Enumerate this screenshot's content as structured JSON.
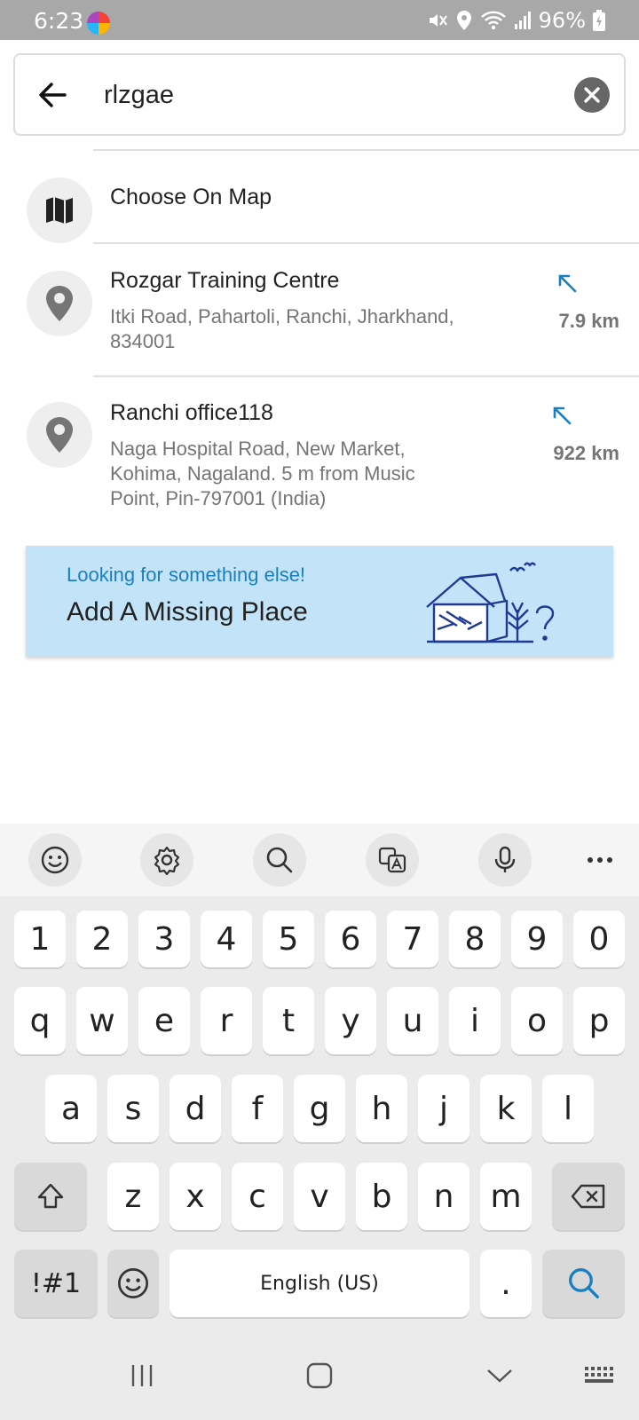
{
  "status_bar": {
    "time": "6:23",
    "battery": "96%"
  },
  "search": {
    "query": "rlzgae"
  },
  "results": [
    {
      "title": "Choose On Map"
    },
    {
      "title": "Rozgar Training Centre",
      "address_line1": "Itki Road, Pahartoli, Ranchi, Jharkhand,",
      "address_line2": "834001",
      "distance": "7.9 km"
    },
    {
      "title": "Ranchi office118",
      "address_line1": "Naga Hospital Road, New Market,",
      "address_line2": "Kohima, Nagaland. 5 m from Music",
      "address_line3": "Point, Pin-797001 (India)",
      "distance": "922 km"
    }
  ],
  "banner": {
    "subtitle": "Looking for something else!",
    "title": "Add A Missing Place"
  },
  "keyboard": {
    "numbers": [
      "1",
      "2",
      "3",
      "4",
      "5",
      "6",
      "7",
      "8",
      "9",
      "0"
    ],
    "row1": [
      "q",
      "w",
      "e",
      "r",
      "t",
      "y",
      "u",
      "i",
      "o",
      "p"
    ],
    "row2": [
      "a",
      "s",
      "d",
      "f",
      "g",
      "h",
      "j",
      "k",
      "l"
    ],
    "row3": [
      "z",
      "x",
      "c",
      "v",
      "b",
      "n",
      "m"
    ],
    "symbols_key": "!#1",
    "space_label": "English (US)",
    "period_key": "."
  },
  "colors": {
    "accent": "#1a7fc0",
    "banner_bg": "#c3e4f8",
    "status_bar_bg": "#a8a8a8"
  }
}
